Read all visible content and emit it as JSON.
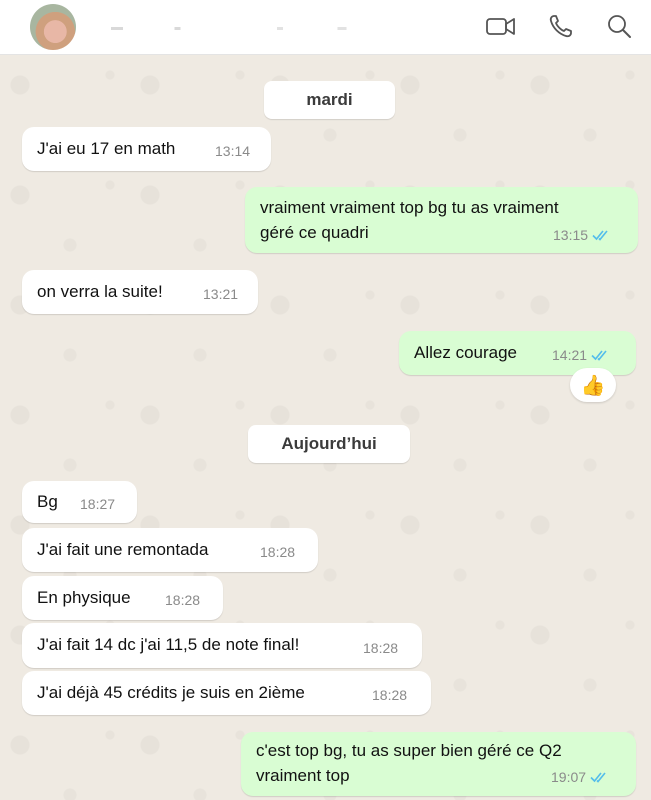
{
  "header": {
    "icons": [
      "video-camera-icon",
      "phone-icon",
      "search-icon"
    ]
  },
  "chat": {
    "date_1": "mardi",
    "date_2": "Aujourd’hui",
    "messages": [
      {
        "text": "J'ai eu 17 en math",
        "time": "13:14",
        "dir": "in"
      },
      {
        "text1": "vraiment vraiment top bg tu as vraiment",
        "text2": "géré ce quadri",
        "time": "13:15",
        "dir": "out"
      },
      {
        "text": "on verra la suite!",
        "time": "13:21",
        "dir": "in"
      },
      {
        "text": "Allez courage",
        "time": "14:21",
        "dir": "out",
        "reaction": "👍"
      },
      {
        "text": "Bg",
        "time": "18:27",
        "dir": "in"
      },
      {
        "text": "J'ai fait une remontada",
        "time": "18:28",
        "dir": "in"
      },
      {
        "text": "En physique",
        "time": "18:28",
        "dir": "in"
      },
      {
        "text": "J'ai fait 14 dc j'ai 11,5 de note final!",
        "time": "18:28",
        "dir": "in"
      },
      {
        "text": "J'ai déjà 45 crédits je suis en 2ième",
        "time": "18:28",
        "dir": "in"
      },
      {
        "text1": "c'est top bg, tu as super bien géré ce Q2",
        "text2": "vraiment top",
        "time": "19:07",
        "dir": "out"
      }
    ]
  },
  "colors": {
    "incoming": "#ffffff",
    "outgoing": "#d9fdd3",
    "read_ticks": "#53bdeb",
    "chat_background": "#efeae2"
  }
}
